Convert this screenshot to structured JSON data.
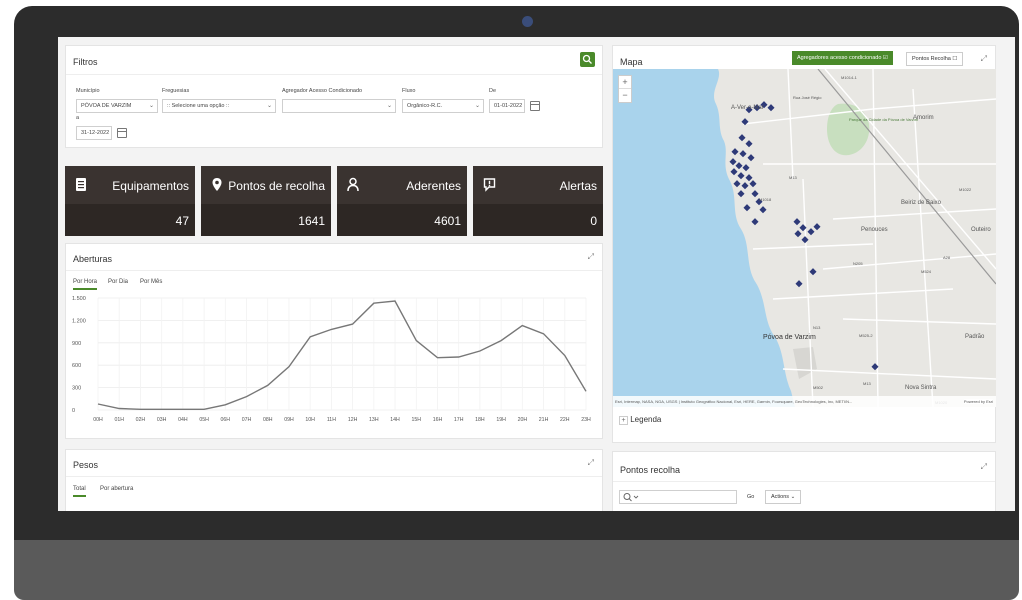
{
  "filters": {
    "title": "Filtros",
    "municipio_label": "Município",
    "municipio_value": "PÓVOA DE VARZIM",
    "freguesias_label": "Freguesias",
    "freguesias_value": ":: Selecione uma opção ::",
    "agregador_label": "Agregador Acesso Condicionado",
    "agregador_value": "",
    "fluxo_label": "Fluxo",
    "fluxo_value": "Orgânico-R.C.",
    "de_label": "De",
    "de_value": "01-01-2022",
    "a_label": "a",
    "a_value": "31-12-2022",
    "search_icon": "search-icon"
  },
  "kpis": [
    {
      "label": "Equipamentos",
      "value": "47",
      "icon": "document-icon"
    },
    {
      "label": "Pontos de recolha",
      "value": "1641",
      "icon": "map-pin-icon"
    },
    {
      "label": "Aderentes",
      "value": "4601",
      "icon": "user-icon"
    },
    {
      "label": "Alertas",
      "value": "0",
      "icon": "alert-icon"
    }
  ],
  "aberturas": {
    "title": "Aberturas",
    "tabs": [
      "Por Hora",
      "Por Dia",
      "Por Mês"
    ]
  },
  "chart_data": {
    "type": "line",
    "title": "",
    "xlabel": "",
    "ylabel": "",
    "ylim": [
      0,
      1500
    ],
    "yticks": [
      "1.500",
      "1.200",
      "900",
      "600",
      "300",
      "0"
    ],
    "categories": [
      "00H",
      "01H",
      "02H",
      "03H",
      "04H",
      "05H",
      "06H",
      "07H",
      "08H",
      "09H",
      "10H",
      "11H",
      "12H",
      "13H",
      "14H",
      "15H",
      "16H",
      "17H",
      "18H",
      "19H",
      "20H",
      "21H",
      "22H",
      "23H"
    ],
    "values": [
      80,
      20,
      10,
      10,
      10,
      10,
      70,
      180,
      330,
      580,
      980,
      1080,
      1150,
      1430,
      1460,
      930,
      700,
      710,
      790,
      930,
      1130,
      1020,
      730,
      250
    ],
    "grid": true,
    "line_color": "#777777"
  },
  "pesos": {
    "title": "Pesos",
    "tabs": [
      "Total",
      "Por abertura"
    ]
  },
  "mapa": {
    "title": "Mapa",
    "btn_agregadores": "Agregadores acesso condicionado",
    "btn_pontos": "Pontos Recolha",
    "attribution": "Esri, Intermap, NASA, NGA, USGS | Instituto Geográfico Nacional, Esri, HERE, Garmin, Foursquare, GeoTechnologies, Inc, METI/N...",
    "powered": "Powered by Esri",
    "legend": "Legenda",
    "labels": {
      "amorim": "Amorim",
      "agucadoura": "A-Ver-o-Mar",
      "rua_jose": "Rua José Régio",
      "parque": "Parque da Cidade da Póvoa de Varzim",
      "beiriz": "Beiriz de Baixo",
      "penouces": "Penouces",
      "outeiro": "Outeiro",
      "povoa": "Póvoa de Varzim",
      "padrao": "Padrão",
      "nova_sintra": "Nova Sintra",
      "r1": "M1014-1",
      "r2": "M13",
      "r3": "M1018",
      "r4": "N205",
      "r5": "M524",
      "r6": "M525-2",
      "r7": "N13",
      "r8": "M1022",
      "r9": "A28",
      "r10": "M1020",
      "r11": "M13",
      "r12": "M502"
    }
  },
  "pontos": {
    "title": "Pontos recolha",
    "go": "Go",
    "actions": "Actions"
  }
}
